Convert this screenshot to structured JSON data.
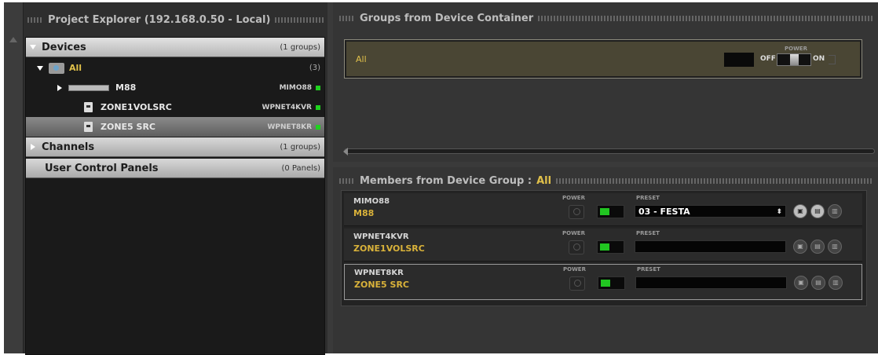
{
  "explorer": {
    "title": "Project Explorer (192.168.0.50 - Local)",
    "devices_label": "Devices",
    "devices_count": "(1 groups)",
    "all_label": "All",
    "all_count": "(3)",
    "items": [
      {
        "name": "M88",
        "model": "MIMO88",
        "status_color": "#1fd11f"
      },
      {
        "name": "ZONE1VOLSRC",
        "model": "WPNET4KVR",
        "status_color": "#1fd11f"
      },
      {
        "name": "ZONE5 SRC",
        "model": "WPNET8KR",
        "status_color": "#1fd11f"
      }
    ],
    "channels_label": "Channels",
    "channels_count": "(1 groups)",
    "ucp_label": "User Control Panels",
    "ucp_count": "(0 Panels)"
  },
  "groups": {
    "title": "Groups from Device Container",
    "group_name": "All",
    "power_label": "POWER",
    "off_label": "OFF",
    "on_label": "ON"
  },
  "members": {
    "title_prefix": "Members from Device Group :",
    "group": "All",
    "power_label": "POWER",
    "preset_label": "PRESET",
    "rows": [
      {
        "model": "MIMO88",
        "name": "M88",
        "preset": "03 - FESTA",
        "preset_arrows": "⬍"
      },
      {
        "model": "WPNET4KVR",
        "name": "ZONE1VOLSRC",
        "preset": ""
      },
      {
        "model": "WPNET8KR",
        "name": "ZONE5 SRC",
        "preset": ""
      }
    ]
  },
  "accent_color": "#e0c04a",
  "name_color": "#d9b23a"
}
